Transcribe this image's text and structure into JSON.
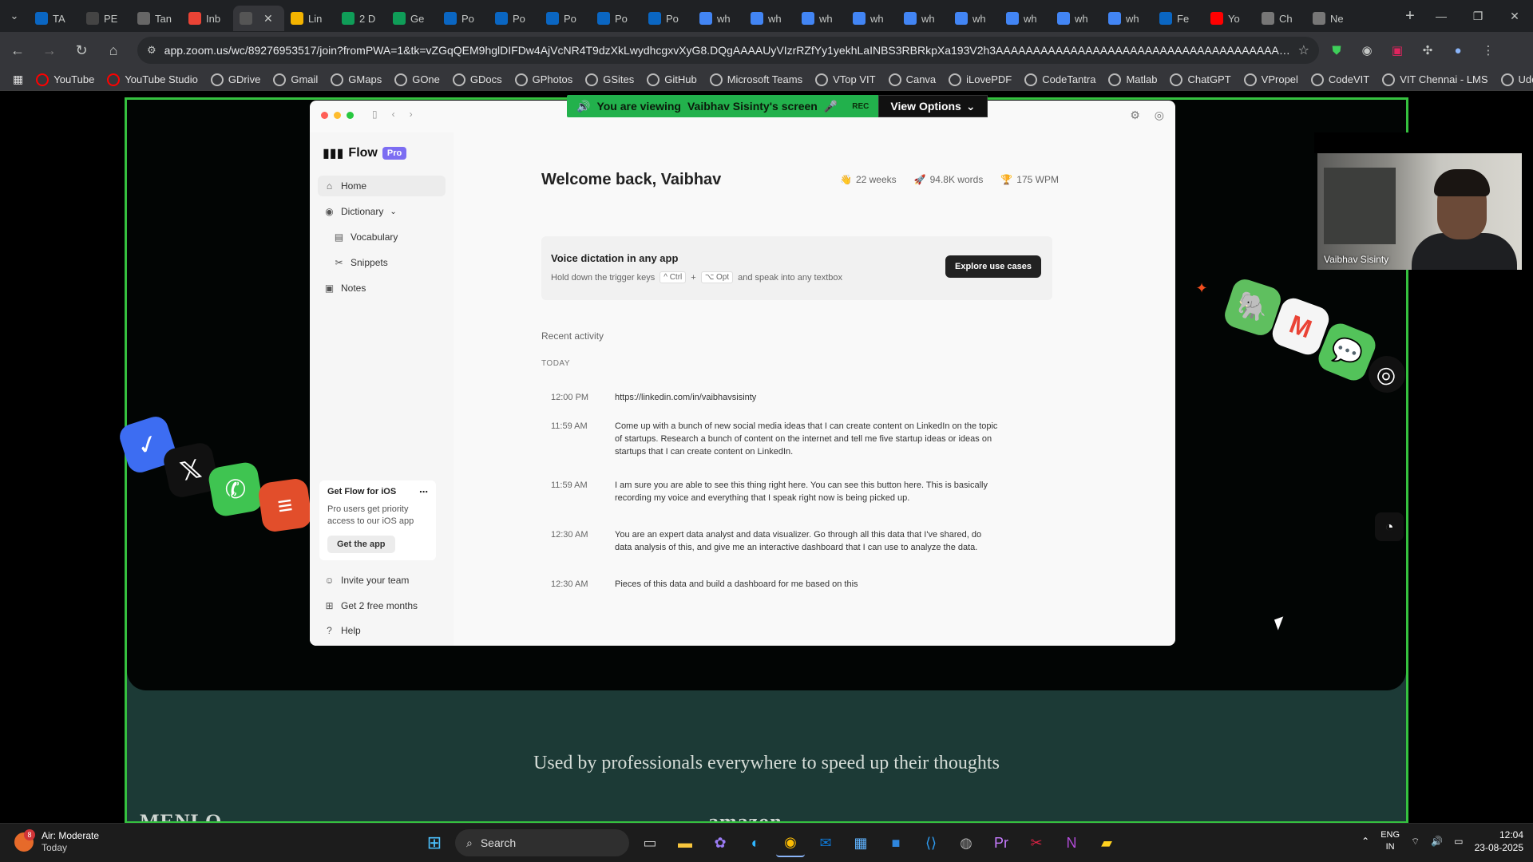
{
  "browser": {
    "tabs": [
      {
        "label": "TA",
        "icon": "in",
        "color": "#0a66c2"
      },
      {
        "label": "PE",
        "icon": "github",
        "color": "#444"
      },
      {
        "label": "Tan",
        "icon": "globe",
        "color": "#666"
      },
      {
        "label": "Inb",
        "icon": "M",
        "color": "#ea4335"
      },
      {
        "label": "",
        "icon": "speaker",
        "color": "#555",
        "active": true
      },
      {
        "label": "Lin",
        "icon": "dots",
        "color": "#f4b400"
      },
      {
        "label": "2 D",
        "icon": "sheet",
        "color": "#0f9d58"
      },
      {
        "label": "Ge",
        "icon": "sheet",
        "color": "#0f9d58"
      },
      {
        "label": "Po",
        "icon": "in",
        "color": "#0a66c2"
      },
      {
        "label": "Po",
        "icon": "in",
        "color": "#0a66c2"
      },
      {
        "label": "Po",
        "icon": "in",
        "color": "#0a66c2"
      },
      {
        "label": "Po",
        "icon": "in",
        "color": "#0a66c2"
      },
      {
        "label": "Po",
        "icon": "in",
        "color": "#0a66c2"
      },
      {
        "label": "wh",
        "icon": "G",
        "color": "#4285f4"
      },
      {
        "label": "wh",
        "icon": "G",
        "color": "#4285f4"
      },
      {
        "label": "wh",
        "icon": "G",
        "color": "#4285f4"
      },
      {
        "label": "wh",
        "icon": "G",
        "color": "#4285f4"
      },
      {
        "label": "wh",
        "icon": "G",
        "color": "#4285f4"
      },
      {
        "label": "wh",
        "icon": "G",
        "color": "#4285f4"
      },
      {
        "label": "wh",
        "icon": "G",
        "color": "#4285f4"
      },
      {
        "label": "wh",
        "icon": "G",
        "color": "#4285f4"
      },
      {
        "label": "wh",
        "icon": "G",
        "color": "#4285f4"
      },
      {
        "label": "Fe",
        "icon": "in",
        "color": "#0a66c2"
      },
      {
        "label": "Yo",
        "icon": "yt",
        "color": "#ff0000"
      },
      {
        "label": "Ch",
        "icon": "chatgpt",
        "color": "#777"
      },
      {
        "label": "Ne",
        "icon": "globe",
        "color": "#777"
      }
    ],
    "url": "app.zoom.us/wc/89276953517/join?fromPWA=1&tk=vZGqQEM9hglDIFDw4AjVcNR4T9dzXkLwydhcgxvXyG8.DQgAAAAUyVIzrRZfYy1yekhLaINBS3RBRkpXa193V2h3AAAAAAAAAAAAAAAAAAAAAAAAAAAAAAAAAAAAAAA&_x_zm_r...",
    "bookmarks": [
      "YouTube",
      "YouTube Studio",
      "GDrive",
      "Gmail",
      "GMaps",
      "GOne",
      "GDocs",
      "GPhotos",
      "GSites",
      "GitHub",
      "Microsoft Teams",
      "VTop VIT",
      "Canva",
      "iLovePDF",
      "CodeTantra",
      "Matlab",
      "ChatGPT",
      "VPropel",
      "CodeVIT",
      "VIT Chennai - LMS",
      "Udemy"
    ]
  },
  "zoom": {
    "viewing_prefix": "You are viewing",
    "viewing_name": "Vaibhav Sisinty's screen",
    "rec": "REC",
    "view_options": "View Options",
    "participant_name": "Vaibhav Sisinty"
  },
  "flow": {
    "brand": "Flow",
    "badge": "Pro",
    "nav": [
      "Home",
      "Dictionary",
      "Vocabulary",
      "Snippets",
      "Notes"
    ],
    "ios_title": "Get Flow for iOS",
    "ios_text": "Pro users get priority access to our iOS app",
    "ios_button": "Get the app",
    "bottom_nav": [
      "Invite your team",
      "Get 2 free months",
      "Help"
    ],
    "welcome": "Welcome back, Vaibhav",
    "stats": [
      "22 weeks",
      "94.8K words",
      "175 WPM"
    ],
    "voice_title": "Voice dictation in any app",
    "voice_prefix": "Hold down the trigger keys",
    "key1": "^ Ctrl",
    "plus": "+",
    "key2": "⌥ Opt",
    "voice_suffix": "and speak into any textbox",
    "explore": "Explore use cases",
    "recent": "Recent activity",
    "today": "TODAY",
    "activity": [
      {
        "time": "12:00 PM",
        "text": "https://linkedin.com/in/vaibhavsisinty"
      },
      {
        "time": "11:59 AM",
        "text": "Come up with a bunch of new social media ideas that I can create content on LinkedIn on the topic of startups. Research a bunch of content on the internet and tell me five startup ideas or ideas on startups that I can create content on LinkedIn."
      },
      {
        "time": "11:59 AM",
        "text": "I am sure you are able to see this thing right here. You can see this button here. This is basically recording my voice and everything that I speak right now is being picked up."
      },
      {
        "time": "12:30 AM",
        "text": "You are an expert data analyst and data visualizer. Go through all this data that I've shared, do data analysis of this, and give me an interactive dashboard that I can use to analyze the data."
      },
      {
        "time": "12:30 AM",
        "text": "Pieces of this data and build a dashboard for me based on this"
      }
    ]
  },
  "website": {
    "tagline": "Used by professionals everywhere to speed up their thoughts",
    "logos": [
      "MENLO",
      "amazon"
    ]
  },
  "taskbar": {
    "weather_title": "Air: Moderate",
    "weather_sub": "Today",
    "weather_badge": "8",
    "search": "Search",
    "lang1": "ENG",
    "lang2": "IN",
    "time": "12:04",
    "date": "23-08-2025"
  }
}
